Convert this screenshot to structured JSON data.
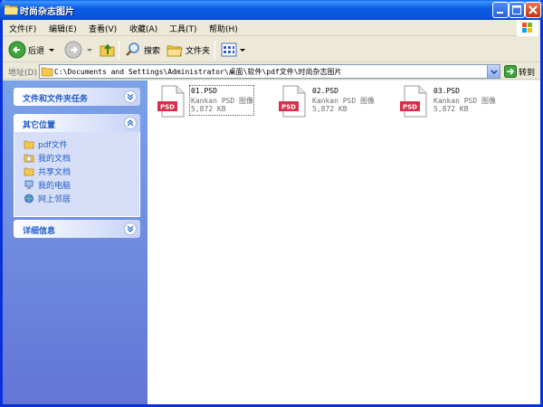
{
  "window": {
    "title": "时尚杂志图片"
  },
  "menu": [
    {
      "label": "文件(F)"
    },
    {
      "label": "编辑(E)"
    },
    {
      "label": "查看(V)"
    },
    {
      "label": "收藏(A)"
    },
    {
      "label": "工具(T)"
    },
    {
      "label": "帮助(H)"
    }
  ],
  "toolbar": {
    "back_label": "后退",
    "search_label": "搜索",
    "folders_label": "文件夹"
  },
  "address": {
    "label": "地址(D)",
    "path": "C:\\Documents and Settings\\Administrator\\桌面\\软件\\pdf文件\\时尚杂志图片",
    "go_label": "转到"
  },
  "sidebar": {
    "tasks": {
      "title": "文件和文件夹任务"
    },
    "other": {
      "title": "其它位置",
      "items": [
        {
          "label": "pdf文件",
          "icon": "folder-icon"
        },
        {
          "label": "我的文档",
          "icon": "my-documents-icon"
        },
        {
          "label": "共享文档",
          "icon": "shared-folder-icon"
        },
        {
          "label": "我的电脑",
          "icon": "my-computer-icon"
        },
        {
          "label": "网上邻居",
          "icon": "network-icon"
        }
      ]
    },
    "details": {
      "title": "详细信息"
    }
  },
  "files": [
    {
      "name": "01.PSD",
      "type": "Kankan PSD 图像",
      "size": "5,872 KB",
      "icon_text": "PSD"
    },
    {
      "name": "02.PSD",
      "type": "Kankan PSD 图像",
      "size": "5,872 KB",
      "icon_text": "PSD"
    },
    {
      "name": "03.PSD",
      "type": "Kankan PSD 图像",
      "size": "5,872 KB",
      "icon_text": "PSD"
    }
  ],
  "colors": {
    "titlebar": "#0b5ee4",
    "sidebar_link": "#215dc6",
    "psd_badge": "#d8304a"
  }
}
